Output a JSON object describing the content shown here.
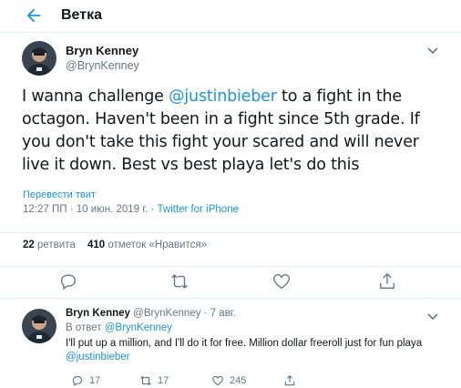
{
  "header": {
    "title": "Ветка"
  },
  "tweet": {
    "author_name": "Bryn Kenney",
    "author_handle": "@BrynKenney",
    "text_before": "I wanna challenge ",
    "mention": "@justinbieber",
    "text_after": " to a fight in the octagon.  Haven't been in a fight since 5th grade.  If you don't take this fight your scared and will never live it down.  Best vs best playa let's do this",
    "translate_label": "Перевести твит",
    "time": "12:27 ПП · 10 июн. 2019 г.",
    "separator": " · ",
    "source": "Twitter for iPhone",
    "retweets_count": "22",
    "retweets_label": "ретвита",
    "likes_count": "410",
    "likes_label": "отметок «Нравится»"
  },
  "reply": {
    "author_name": "Bryn Kenney",
    "author_handle": "@BrynKenney",
    "date_sep": " · ",
    "date": "7 авг.",
    "reply_to_label": "В ответ ",
    "reply_to_handle": "@BrynKenney",
    "text": "I'll put up a million, and I'll do it for free.  Million dollar freeroll just for fun playa ",
    "mention": "@justinbieber",
    "replies_count": "17",
    "retweets_count": "17",
    "likes_count": "245"
  },
  "icons": {
    "back": "arrow-left-icon",
    "caret": "chevron-down-icon",
    "reply": "speech-bubble-icon",
    "retweet": "retweet-icon",
    "like": "heart-icon",
    "share": "share-icon"
  },
  "colors": {
    "accent": "#1b95e0",
    "secondary_text": "#657786",
    "primary_text": "#14171a",
    "border": "#e6ecf0"
  }
}
